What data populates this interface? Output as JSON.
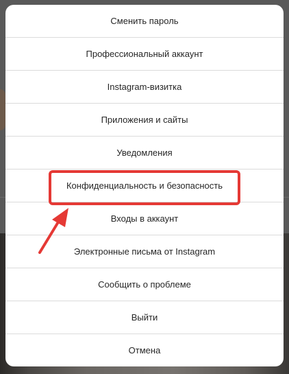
{
  "menu": {
    "items": [
      {
        "label": "Сменить пароль"
      },
      {
        "label": "Профессиональный аккаунт"
      },
      {
        "label": "Instagram-визитка"
      },
      {
        "label": "Приложения и сайты"
      },
      {
        "label": "Уведомления"
      },
      {
        "label": "Конфиденциальность и безопасность"
      },
      {
        "label": "Входы в аккаунт"
      },
      {
        "label": "Электронные письма от Instagram"
      },
      {
        "label": "Сообщить о проблеме"
      },
      {
        "label": "Выйти"
      },
      {
        "label": "Отмена"
      }
    ]
  },
  "annotation": {
    "highlight_color": "#e53935",
    "highlighted_item": "Конфиденциальность и безопасность"
  }
}
